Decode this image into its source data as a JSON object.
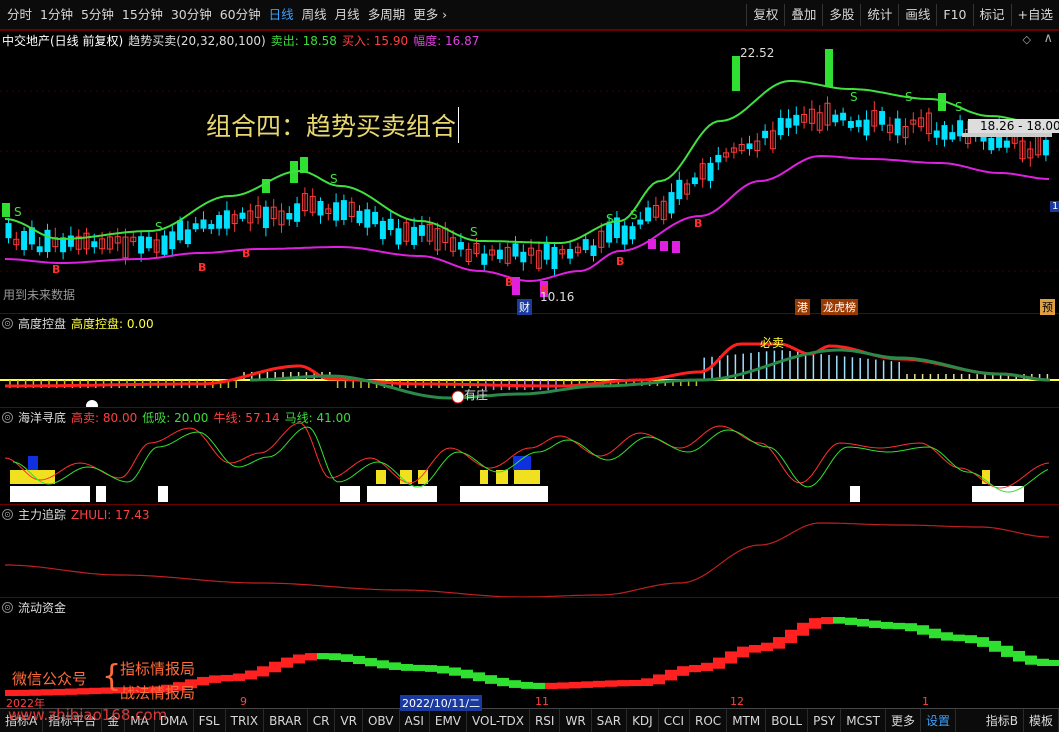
{
  "toolbar": {
    "periods": [
      "分时",
      "1分钟",
      "5分钟",
      "15分钟",
      "30分钟",
      "60分钟",
      "日线",
      "周线",
      "月线",
      "多周期",
      "更多"
    ],
    "active": "日线",
    "right_buttons": [
      "复权",
      "叠加",
      "多股",
      "统计",
      "画线",
      "F10",
      "标记",
      "+自选"
    ]
  },
  "main_chart": {
    "stock": "中交地产(日线 前复权)",
    "indicator": "趋势买卖(20,32,80,100)",
    "sell_label": "卖出: 18.58",
    "buy_label": "买入: 15.90",
    "range_label": "幅度: 16.87",
    "title_overlay": "组合四：趋势买卖组合",
    "high_label": "22.52",
    "low_label": "10.16",
    "price_range": "18.26 - 18.00",
    "future_note": "用到未来数据",
    "marks": {
      "s": "S",
      "b": "B",
      "cai": "财",
      "gang": "港",
      "longhu": "龙虎榜",
      "yu": "预"
    },
    "right_edge": "1"
  },
  "panels": {
    "gaodu": {
      "name": "高度控盘",
      "label": "高度控盘: 0.00",
      "bisell": "必卖",
      "support": "有庄"
    },
    "haiyang": {
      "name": "海洋寻底",
      "high_sell": "高卖: 80.00",
      "low_buy": "低吸: 20.00",
      "niu": "牛线: 57.14",
      "ma": "马线: 41.00"
    },
    "zhuli": {
      "name": "主力追踪",
      "label": "ZHULI: 17.43"
    },
    "liudong": {
      "name": "流动资金",
      "wechat": "微信公众号",
      "brand1": "指标情报局",
      "brand2": "战法情报局"
    }
  },
  "axis": {
    "year": "2022年",
    "date": "2022/10/11/二",
    "m11": "11",
    "m12": "12",
    "m1": "1",
    "m9": "9",
    "watermark": "www.zhibiao168.com"
  },
  "bottom_tabs": [
    "指标A",
    "指标平台",
    "金",
    "MA",
    "DMA",
    "FSL",
    "TRIX",
    "BRAR",
    "CR",
    "VR",
    "OBV",
    "ASI",
    "EMV",
    "VOL-TDX",
    "RSI",
    "WR",
    "SAR",
    "KDJ",
    "CCI",
    "ROC",
    "MTM",
    "BOLL",
    "PSY",
    "MCST",
    "更多",
    "设置"
  ],
  "bottom_right": [
    "指标B",
    "模板"
  ],
  "colors": {
    "up": "#ff3b3b",
    "down": "#00e0ff",
    "green": "#3cdc3c",
    "magenta": "#e020e0",
    "yellow": "#ffff40",
    "label_blue": "#3aa0ff"
  }
}
